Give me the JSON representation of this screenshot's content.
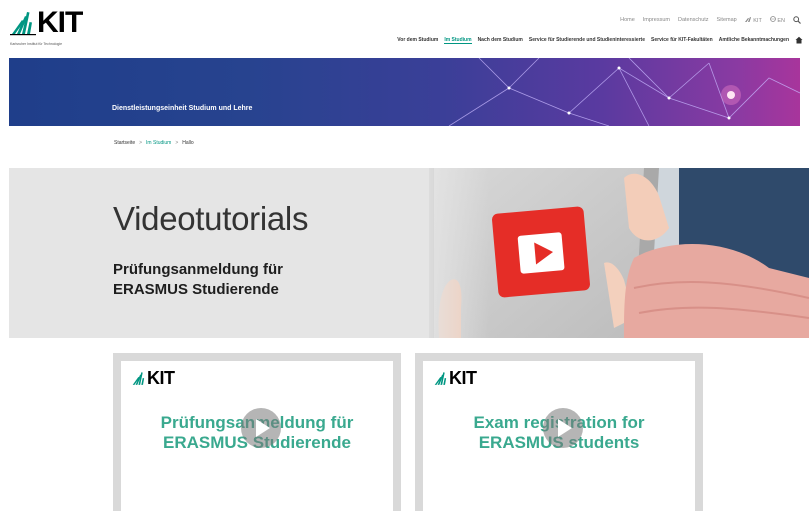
{
  "header": {
    "logo_text": "KIT",
    "logo_sub": "Karlsruher Institut für Technologie",
    "meta_nav": [
      "Home",
      "Impressum",
      "Datenschutz",
      "Sitemap",
      "KIT",
      "EN"
    ],
    "main_nav": [
      {
        "label": "Vor dem Studium",
        "active": false
      },
      {
        "label": "Im Studium",
        "active": true
      },
      {
        "label": "Nach dem Studium",
        "active": false
      },
      {
        "label": "Service für Studierende und Studieninteressierte",
        "active": false
      },
      {
        "label": "Service für KIT-Fakultäten",
        "active": false
      },
      {
        "label": "Amtliche Bekanntmachungen",
        "active": false
      }
    ]
  },
  "banner": {
    "title": "Dienstleistungseinheit Studium und Lehre"
  },
  "breadcrumb": {
    "home": "Startseite",
    "sep1": ">",
    "section": "Im Studium",
    "sep2": ">",
    "current": "Hallo"
  },
  "hero": {
    "title": "Videotutorials",
    "subtitle_line1": "Prüfungsanmeldung für",
    "subtitle_line2": "ERASMUS Studierende"
  },
  "videos": [
    {
      "logo": "KIT",
      "line1": "Prüfungsanmeldung für",
      "line2": "ERASMUS Studierende"
    },
    {
      "logo": "KIT",
      "line1": "Exam registration for",
      "line2": "ERASMUS students"
    }
  ],
  "colors": {
    "accent": "#009682",
    "video_title": "#3aa98f",
    "youtube_red": "#e52d27"
  }
}
